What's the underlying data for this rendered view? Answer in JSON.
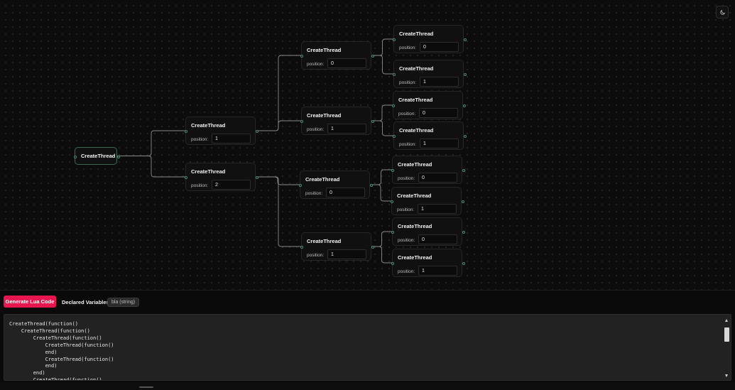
{
  "flow": {
    "nodes": [
      {
        "id": "n0",
        "title": "CreateThread",
        "root": true
      },
      {
        "id": "n1",
        "title": "CreateThread",
        "position_label": "position:",
        "position": "1"
      },
      {
        "id": "n2",
        "title": "CreateThread",
        "position_label": "position:",
        "position": "2"
      },
      {
        "id": "n3",
        "title": "CreateThread",
        "position_label": "position:",
        "position": "0"
      },
      {
        "id": "n4",
        "title": "CreateThread",
        "position_label": "position:",
        "position": "1"
      },
      {
        "id": "n5",
        "title": "CreateThread",
        "position_label": "position:",
        "position": "0"
      },
      {
        "id": "n6",
        "title": "CreateThread",
        "position_label": "position:",
        "position": "1"
      },
      {
        "id": "n7",
        "title": "CreateThread",
        "position_label": "position:",
        "position": "0"
      },
      {
        "id": "n8",
        "title": "CreateThread",
        "position_label": "position:",
        "position": "1"
      },
      {
        "id": "n9",
        "title": "CreateThread",
        "position_label": "position:",
        "position": "0"
      },
      {
        "id": "n10",
        "title": "CreateThread",
        "position_label": "position:",
        "position": "1"
      },
      {
        "id": "n11",
        "title": "CreateThread",
        "position_label": "position:",
        "position": "0"
      },
      {
        "id": "n12",
        "title": "CreateThread",
        "position_label": "position:",
        "position": "1"
      },
      {
        "id": "n13",
        "title": "CreateThread",
        "position_label": "position:",
        "position": "0"
      },
      {
        "id": "n14",
        "title": "CreateThread",
        "position_label": "position:",
        "position": "1"
      }
    ],
    "edges": [
      [
        "n0",
        "n1"
      ],
      [
        "n0",
        "n2"
      ],
      [
        "n1",
        "n3"
      ],
      [
        "n1",
        "n4"
      ],
      [
        "n2",
        "n5"
      ],
      [
        "n2",
        "n6"
      ],
      [
        "n3",
        "n7"
      ],
      [
        "n3",
        "n8"
      ],
      [
        "n4",
        "n9"
      ],
      [
        "n4",
        "n10"
      ],
      [
        "n5",
        "n11"
      ],
      [
        "n5",
        "n12"
      ],
      [
        "n6",
        "n13"
      ],
      [
        "n6",
        "n14"
      ]
    ],
    "edge_color": "#8a8a8a",
    "handle_color": "#4f8a6d"
  },
  "theme_toggle": {
    "icon": "moon-icon"
  },
  "toolbar": {
    "generate_label": "Generate Lua Code",
    "declared_label": "Declared Variables:",
    "variables": [
      "bla (string)"
    ],
    "accent": "#e8164f"
  },
  "code": {
    "text": "CreateThread(function()\n    CreateThread(function()\n        CreateThread(function()\n            CreateThread(function()\n            end)\n            CreateThread(function()\n            end)\n        end)\n        CreateThread(function()"
  }
}
